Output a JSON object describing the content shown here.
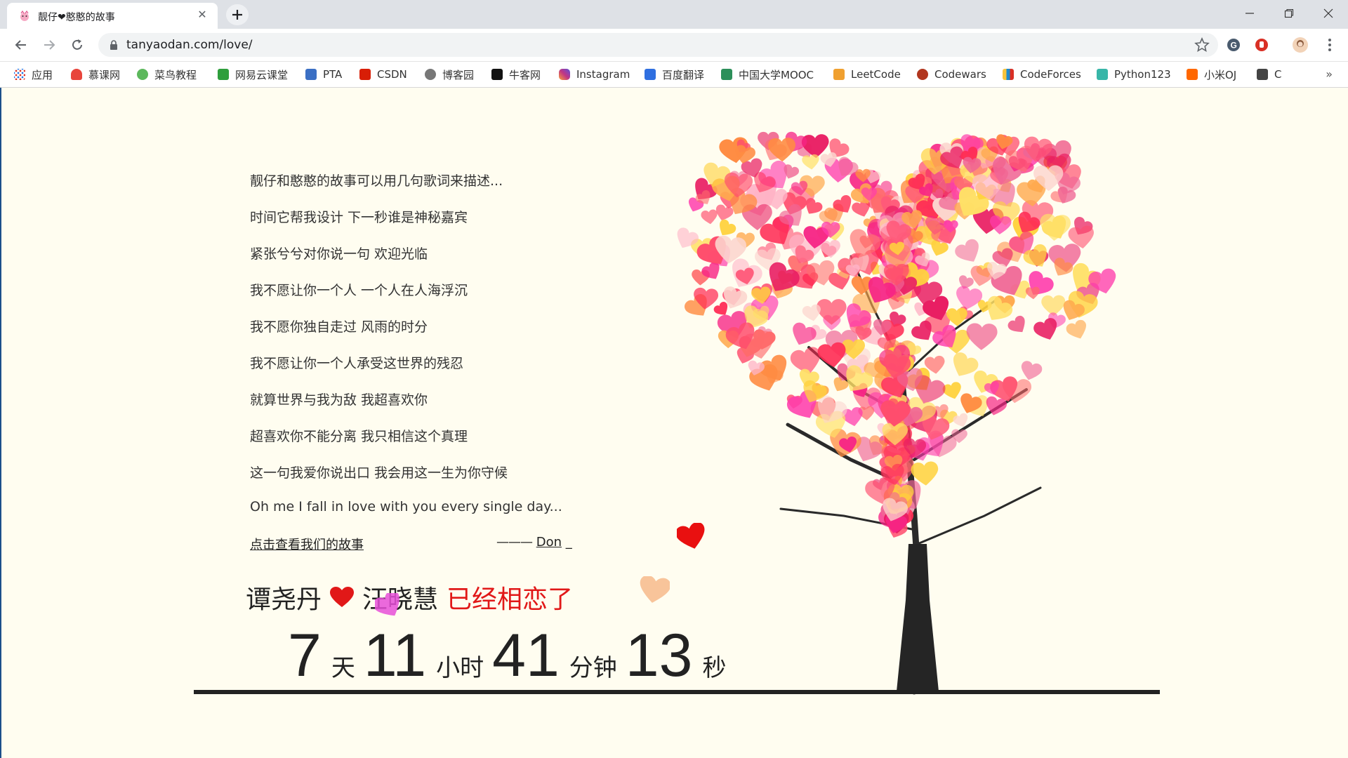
{
  "browser": {
    "tab_title": "靓仔❤憨憨的故事",
    "url": "tanyaodan.com/love/"
  },
  "bookmarks": [
    {
      "label": "应用",
      "color": "#d93025"
    },
    {
      "label": "慕课网",
      "color": "#e8453c"
    },
    {
      "label": "菜鸟教程",
      "color": "#5cb85c"
    },
    {
      "label": "网易云课堂",
      "color": "#2e9e3c"
    },
    {
      "label": "PTA",
      "color": "#3b6fc4"
    },
    {
      "label": "CSDN",
      "color": "#d81e06"
    },
    {
      "label": "博客园",
      "color": "#555555"
    },
    {
      "label": "牛客网",
      "color": "#111111"
    },
    {
      "label": "Instagram",
      "color": "#c13584"
    },
    {
      "label": "百度翻译",
      "color": "#2f6fe0"
    },
    {
      "label": "中国大学MOOC",
      "color": "#2c8f5a"
    },
    {
      "label": "LeetCode",
      "color": "#f0a030"
    },
    {
      "label": "Codewars",
      "color": "#b1361e"
    },
    {
      "label": "CodeForces",
      "color": "#1f8acb"
    },
    {
      "label": "Python123",
      "color": "#38b6a8"
    },
    {
      "label": "小米OJ",
      "color": "#ff6700"
    },
    {
      "label": "C",
      "color": "#444444"
    }
  ],
  "lyrics": [
    "靓仔和憨憨的故事可以用几句歌词来描述...",
    "时间它帮我设计 下一秒谁是神秘嘉宾",
    "紧张兮兮对你说一句 欢迎光临",
    "我不愿让你一个人 一个人在人海浮沉",
    "我不愿你独自走过 风雨的时分",
    "我不愿让你一个人承受这世界的残忍",
    "就算世界与我为敌 我超喜欢你",
    "超喜欢你不能分离 我只相信这个真理",
    "这一句我爱你说出口 我会用这一生为你守候",
    "Oh me I fall in love with you every single day..."
  ],
  "story_link": "点击查看我们的故事",
  "signature": {
    "dash": "———",
    "name": "Don",
    "trail": "_"
  },
  "couple": {
    "name1": "谭尧丹",
    "name2": "汪晓慧",
    "tail": "已经相恋了"
  },
  "timer": {
    "days": "7",
    "days_unit": "天",
    "hours": "11",
    "hours_unit": "小时",
    "minutes": "41",
    "minutes_unit": "分钟",
    "seconds": "13",
    "seconds_unit": "秒"
  },
  "colors": {
    "heart_red": "#e11818",
    "page_bg": "#fffdf0"
  }
}
